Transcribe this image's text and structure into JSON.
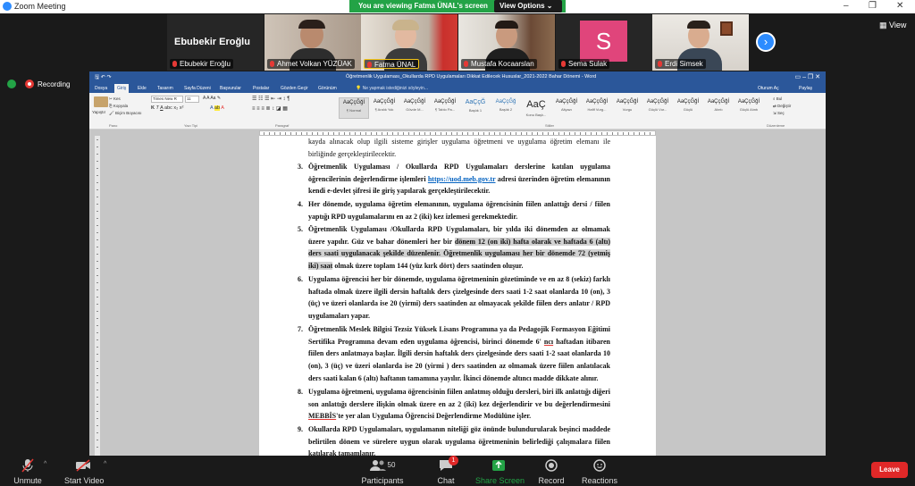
{
  "window": {
    "title": "Zoom Meeting",
    "minimize": "–",
    "maximize": "❐",
    "close": "✕"
  },
  "banner": {
    "viewing": "You are viewing Fatma ÜNAL's screen",
    "view_options": "View Options ⌄"
  },
  "top_right": {
    "view": "View"
  },
  "recording": {
    "label": "Recording"
  },
  "participants": [
    {
      "name": "Ebubekir Eroğlu",
      "display": "Ebubekir Eroğlu"
    },
    {
      "name": "Ahmet Volkan YÜZÜAK"
    },
    {
      "name": "Fatma ÜNAL"
    },
    {
      "name": "Mustafa Kocaarslan"
    },
    {
      "name": "Sema Sulak",
      "initial": "S"
    },
    {
      "name": "Erdi Simsek"
    }
  ],
  "word": {
    "title": "Öğretmenlik Uygulaması_Okullarda RPD Uygulamaları Dikkat Edilecek Hususlar_2021-2022 Bahar Dönemi - Word",
    "tabs": [
      "Dosya",
      "Giriş",
      "Ekle",
      "Tasarım",
      "Sayfa Düzeni",
      "Başvurular",
      "Postalar",
      "Gözden Geçir",
      "Görünüm"
    ],
    "tell_me": "Ne yapmak istediğinizi söyleyin...",
    "account": "Oturum Aç",
    "share": "Paylaş",
    "ribbon": {
      "paste": "Yapıştır",
      "cut": "Kes",
      "copy": "Kopyala",
      "format_painter": "Biçim Boyacısı",
      "font": "Times New R",
      "size": "11",
      "groups": {
        "clipboard": "Pano",
        "font": "Yazı Tipi",
        "paragraph": "Paragraf",
        "styles": "Stiller",
        "editing": "Düzenleme"
      },
      "styles": [
        {
          "preview": "AaÇçĞğİ",
          "label": "¶ Normal"
        },
        {
          "preview": "AaÇçĞğİ",
          "label": "¶ Aralık Yok"
        },
        {
          "preview": "AaÇçĞğİ",
          "label": "Gövde M..."
        },
        {
          "preview": "AaÇçĞğİ",
          "label": "¶ Tablo Pa..."
        },
        {
          "preview": "AaÇçĞ",
          "label": "Başlık 1"
        },
        {
          "preview": "AaÇçĞğ",
          "label": "Başlık 2"
        },
        {
          "preview": "AaÇ",
          "label": "Konu Başlı..."
        },
        {
          "preview": "AaÇçĞğİ",
          "label": "Altyazı"
        },
        {
          "preview": "AaÇçĞğİ",
          "label": "Hafif Vurg..."
        },
        {
          "preview": "AaÇçĞğİ",
          "label": "Vurgu"
        },
        {
          "preview": "AaÇçĞğİ",
          "label": "Güçlü Vur..."
        },
        {
          "preview": "AaÇçĞğİ",
          "label": "Güçlü"
        },
        {
          "preview": "AaÇçĞğİ",
          "label": "Alıntı"
        },
        {
          "preview": "AaÇçĞğİ",
          "label": "Güçlü Alıntı"
        },
        {
          "preview": "AaÇçĞğİ",
          "label": "Hafif Baş..."
        }
      ],
      "find": "Bul",
      "replace": "Değiştir",
      "select": "Seç"
    },
    "doc": {
      "p_cont": "kayda alınacak olup ilgili sisteme girişler uygulama öğretmeni ve uygulama öğretim elemanı ile birliğinde gerçekleştirilecektir.",
      "items": [
        {
          "num": "3.",
          "a": "Öğretmenlik Uygulaması / Okullarda RPD Uygulamaları derslerine katılan uygulama öğrencilerinin değerlendirme işlemleri ",
          "link": "https://uod.meb.gov.tr",
          "b": " adresi üzerinden öğretim elemanının kendi e-devlet şifresi ile giriş yapılarak gerçekleştirilecektir."
        },
        {
          "num": "4.",
          "a": "Her dönemde, uygulama öğretim elemanının, uygulama öğrencisinin fiilen anlattığı dersi / fiilen yaptığı RPD uygulamalarını en az 2 (iki) kez izlemesi gerekmektedir."
        },
        {
          "num": "5.",
          "a": "Öğretmenlik Uygulaması /Okullarda RPD Uygulamaları, bir yılda iki dönemden az olmamak üzere yapılır. Güz ve bahar dönemleri her bir ",
          "hl": "dönem 12 (on iki) hafta olarak ve haftada 6 (altı) ders saati uygulanacak şekilde düzenlenir. Öğretmenlik uygulaması her bir dönemde 72 (yetmiş iki) saat",
          "b": " olmak üzere toplam 144 (yüz kırk dört) ders saatinden oluşur."
        },
        {
          "num": "6.",
          "a": "Uygulama öğrencisi her bir dönemde, uygulama öğretmeninin gözetiminde ve en az 8 (sekiz) farklı haftada olmak üzere ilgili dersin haftalık ders çizelgesinde ders saati 1-2 saat olanlarda 10 (on), 3 (üç) ve üzeri olanlarda ise 20 (yirmi) ders saatinden az olmayacak şekilde fiilen ders anlatır / RPD uygulamaları yapar."
        },
        {
          "num": "7.",
          "a": "Öğretmenlik Meslek Bilgisi Tezsiz Yüksek Lisans Programına ya da Pedagojik Formasyon Eğitimi Sertifika Programına devam eden uygulama öğrencisi, birinci dönemde 6' ",
          "sq": "ncı",
          "b": " haftadan itibaren fiilen ders anlatmaya başlar. İlgili dersin haftalık ders çizelgesinde ders saati 1-2 saat olanlarda 10 (on), 3 (üç) ve üzeri olanlarda ise 20 (yirmi ) ders saatinden az olmamak üzere fiilen anlatılacak ders saati kalan 6 (altı) haftanın tamamına yayılır. İkinci dönemde altıncı madde dikkate alınır."
        },
        {
          "num": "8.",
          "a": "Uygulama öğretmeni, uygulama öğrencisinin fiilen anlatmış olduğu dersleri, biri ilk anlattığı diğeri son anlattığı derslere ilişkin olmak üzere en az 2 (iki) kez değerlendirir ve bu değerlendirmesini ",
          "sq": "MEBBİS",
          "b": "'te yer alan Uygulama Öğrencisi Değerlendirme Modülüne işler."
        },
        {
          "num": "9.",
          "a": "Okullarda RPD Uygulamaları, uygulamanın niteliği göz önünde bulundurularak beşinci maddede belirtilen dönem ve sürelere uygun olarak uygulama öğretmeninin belirlediği çalışmalara fiilen katılarak tamamlanır."
        }
      ]
    }
  },
  "controls": {
    "unmute": "Unmute",
    "start_video": "Start Video",
    "participants": "Participants",
    "participants_count": "50",
    "chat": "Chat",
    "chat_badge": "1",
    "share": "Share Screen",
    "record": "Record",
    "reactions": "Reactions",
    "leave": "Leave"
  },
  "colors": {
    "zoom_blue": "#2d8cff",
    "share_green": "#23a346",
    "word_blue": "#2b579a",
    "leave_red": "#e02828"
  }
}
